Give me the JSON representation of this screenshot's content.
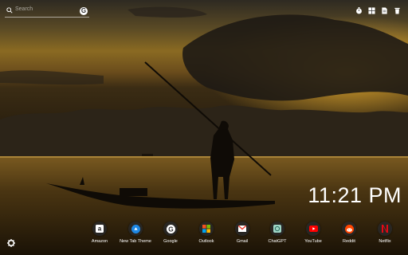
{
  "search": {
    "placeholder": "Search"
  },
  "toolbar": {
    "icons": [
      "timer-icon",
      "grid-icon",
      "note-icon",
      "trash-icon"
    ]
  },
  "clock": {
    "time": "11:21 PM"
  },
  "apps": [
    {
      "label": "Amazon",
      "icon": "amazon-icon",
      "color": "#ffffff"
    },
    {
      "label": "New Tab Theme",
      "icon": "newtab-icon",
      "color": "#1e88e5"
    },
    {
      "label": "Google",
      "icon": "google-icon",
      "color": "#ffffff"
    },
    {
      "label": "Outlook",
      "icon": "microsoft-icon",
      "color": "#f25022"
    },
    {
      "label": "Gmail",
      "icon": "gmail-icon",
      "color": "#ea4335"
    },
    {
      "label": "ChatGPT",
      "icon": "chatgpt-icon",
      "color": "#9fd6c6"
    },
    {
      "label": "YouTube",
      "icon": "youtube-icon",
      "color": "#ff0000"
    },
    {
      "label": "Reddit",
      "icon": "reddit-icon",
      "color": "#ff4500"
    },
    {
      "label": "Netflix",
      "icon": "netflix-icon",
      "color": "#e50914"
    }
  ],
  "settings": {
    "icon": "gear-icon"
  }
}
